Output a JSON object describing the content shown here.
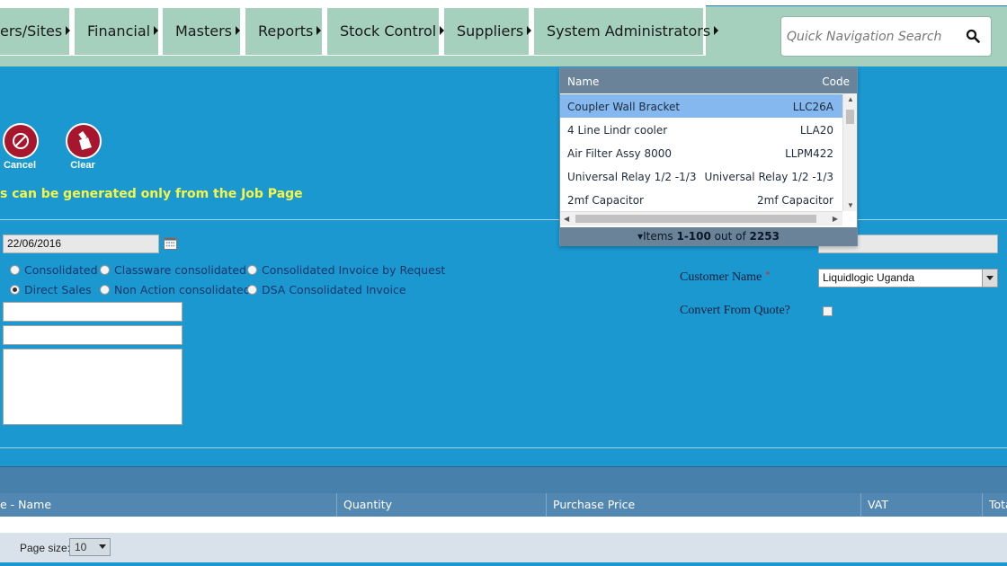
{
  "menu": {
    "items": [
      {
        "label": "ers/Sites"
      },
      {
        "label": "Financial"
      },
      {
        "label": "Masters"
      },
      {
        "label": "Reports"
      },
      {
        "label": "Stock Control"
      },
      {
        "label": "Suppliers"
      },
      {
        "label": "System Administrators"
      }
    ],
    "quick_nav_placeholder": "Quick Navigation Search"
  },
  "actions": {
    "cancel_label": "Cancel",
    "clear_label": "Clear"
  },
  "notice": "s can be generated only from the Job Page",
  "form": {
    "date_value": "22/06/2016",
    "invoice_types": [
      {
        "label": "Consolidated",
        "selected": false
      },
      {
        "label": "Classware consolidated",
        "selected": false
      },
      {
        "label": "Consolidated Invoice by Request",
        "selected": false
      },
      {
        "label": "Direct Sales",
        "selected": true
      },
      {
        "label": "Non Action consolidated",
        "selected": false
      },
      {
        "label": "DSA Consolidated Invoice",
        "selected": false
      }
    ],
    "customer_name_label": "Customer Name",
    "required_mark": "*",
    "customer_name_value": "Liquidlogic Uganda",
    "convert_from_quote_label": "Convert From Quote?"
  },
  "dropdown": {
    "header": {
      "name": "Name",
      "code": "Code"
    },
    "rows": [
      {
        "name": "Coupler Wall Bracket",
        "code": "LLC26A",
        "selected": true
      },
      {
        "name": "4 Line Lindr cooler",
        "code": "LLA20",
        "selected": false
      },
      {
        "name": "Air Filter Assy 8000",
        "code": "LLPM422",
        "selected": false
      },
      {
        "name": "Universal Relay 1/2 -1/3",
        "code": "Universal Relay 1/2 -1/3",
        "selected": false
      },
      {
        "name": "2mf Capacitor",
        "code": "2mf Capacitor",
        "selected": false
      }
    ],
    "footer": {
      "prefix": "Items ",
      "range": "1-100",
      "middle": " out of ",
      "total": "2253"
    }
  },
  "grid": {
    "columns": [
      {
        "label": "e - Name"
      },
      {
        "label": "Quantity"
      },
      {
        "label": "Purchase Price"
      },
      {
        "label": "VAT"
      },
      {
        "label": "Tota"
      }
    ],
    "page_size_label": "Page size:",
    "page_size_value": "10"
  },
  "colors": {
    "background": "#1b98d0",
    "menu_bg": "#a5d0bd",
    "action_button": "#a8162d",
    "notice_text": "#f6f64a",
    "dropdown_selected": "#86b8f0"
  },
  "icons": [
    "cancel-icon",
    "clear-brush-icon",
    "search-icon",
    "calendar-icon",
    "menu-arrow-icon"
  ]
}
